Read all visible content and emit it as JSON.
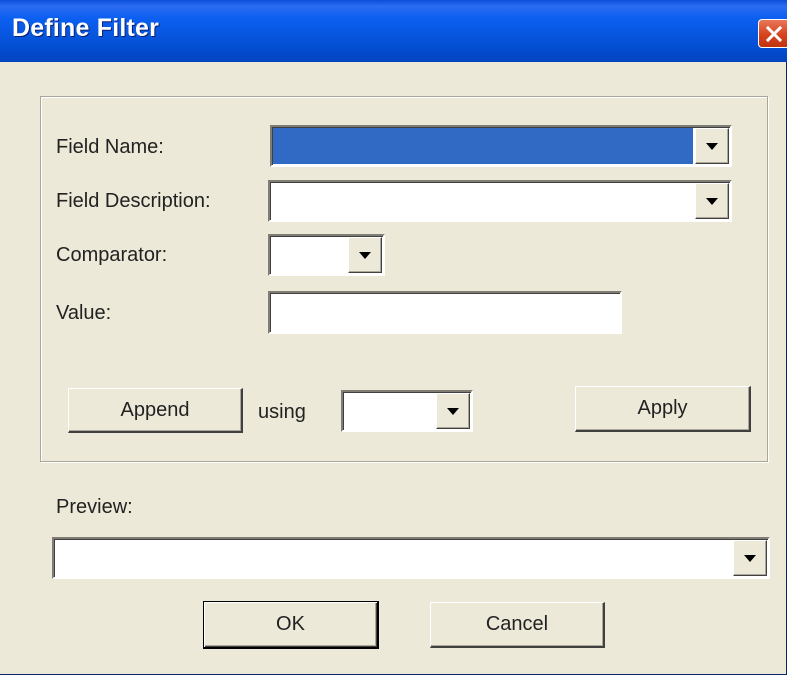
{
  "window": {
    "title": "Define Filter",
    "close_icon": "close-icon"
  },
  "filter": {
    "field_name_label": "Field Name:",
    "field_name_value": "",
    "field_description_label": "Field Description:",
    "field_description_value": "",
    "comparator_label": "Comparator:",
    "comparator_value": "",
    "value_label": "Value:",
    "value_value": "",
    "append_label": "Append",
    "using_label": "using",
    "using_value": "",
    "apply_label": "Apply"
  },
  "preview": {
    "label": "Preview:",
    "value": ""
  },
  "footer": {
    "ok_label": "OK",
    "cancel_label": "Cancel"
  },
  "colors": {
    "titlebar": "#0551d6",
    "dialog_bg": "#ece9d8",
    "selection": "#316ac5",
    "close_button": "#d6431f"
  }
}
